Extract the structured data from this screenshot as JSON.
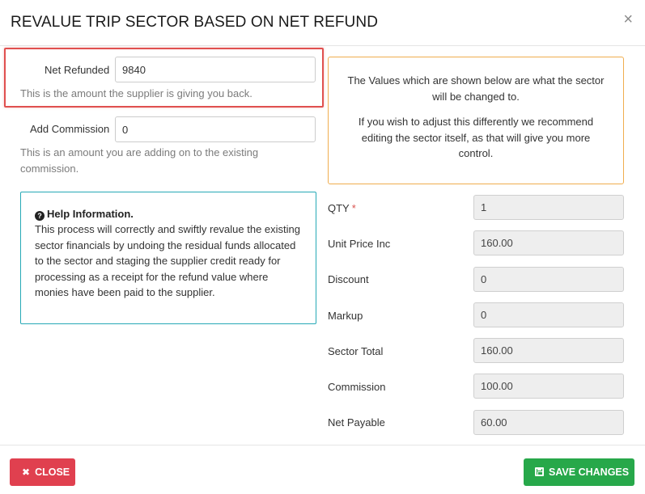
{
  "modal": {
    "title": "REVALUE TRIP SECTOR BASED ON NET REFUND",
    "close_symbol": "×"
  },
  "net_refunded": {
    "label": "Net Refunded",
    "value": "9840",
    "hint": "This is the amount the supplier is giving you back."
  },
  "add_commission": {
    "label": "Add Commission",
    "value": "0",
    "hint": "This is an amount you are adding on to the existing commission."
  },
  "help": {
    "icon": "question-circle-icon",
    "title": "Help Information.",
    "text": "This process will correctly and swiftly revalue the existing sector financials by undoing the residual funds allocated to the sector and staging the supplier credit ready for processing as a receipt for the refund value where monies have been paid to the supplier."
  },
  "info": {
    "line1": "The Values which are shown below are what the sector will be changed to.",
    "line2": "If you wish to adjust this differently we recommend editing the sector itself, as that will give you more control."
  },
  "fields": {
    "qty": {
      "label": "QTY",
      "required_mark": "*",
      "value": "1"
    },
    "unit_price_inc": {
      "label": "Unit Price Inc",
      "value": "160.00"
    },
    "discount": {
      "label": "Discount",
      "value": "0"
    },
    "markup": {
      "label": "Markup",
      "value": "0"
    },
    "sector_total": {
      "label": "Sector Total",
      "value": "160.00"
    },
    "commission": {
      "label": "Commission",
      "value": "100.00"
    },
    "net_payable": {
      "label": "Net Payable",
      "value": "60.00"
    }
  },
  "footer": {
    "close_label": "CLOSE",
    "close_icon": "times-icon",
    "save_label": "SAVE CHANGES",
    "save_icon": "floppy-disk-icon"
  },
  "colors": {
    "highlight": "#e0504f",
    "help_border": "#26a9b6",
    "info_border": "#f0ad4e",
    "close_button": "#e0404f",
    "save_button": "#27a84a",
    "required": "#d9534f"
  }
}
